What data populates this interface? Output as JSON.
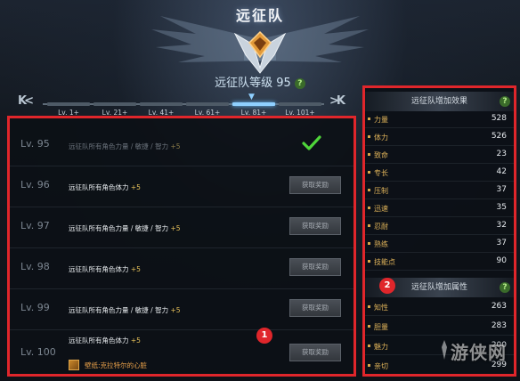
{
  "header": {
    "title": "远征队",
    "level_text": "远征队等级 95",
    "help": "?"
  },
  "nav": {
    "prev": "K<",
    "next": ">K",
    "tiers": [
      {
        "label": "Lv. 1+",
        "active": false
      },
      {
        "label": "Lv. 21+",
        "active": false
      },
      {
        "label": "Lv. 41+",
        "active": false
      },
      {
        "label": "Lv. 61+",
        "active": false
      },
      {
        "label": "Lv. 81+",
        "active": true
      },
      {
        "label": "Lv. 101+",
        "active": false
      }
    ]
  },
  "rewards": [
    {
      "level": "Lv. 95",
      "desc": "远征队所有角色力量 / 敏捷 / 智力",
      "bonus": "+5",
      "claimed": true,
      "button": ""
    },
    {
      "level": "Lv. 96",
      "desc": "远征队所有角色体力",
      "bonus": "+5",
      "claimed": false,
      "button": "获取奖励"
    },
    {
      "level": "Lv. 97",
      "desc": "远征队所有角色力量 / 敏捷 / 智力",
      "bonus": "+5",
      "claimed": false,
      "button": "获取奖励"
    },
    {
      "level": "Lv. 98",
      "desc": "远征队所有角色体力",
      "bonus": "+5",
      "claimed": false,
      "button": "获取奖励"
    },
    {
      "level": "Lv. 99",
      "desc": "远征队所有角色力量 / 敏捷 / 智力",
      "bonus": "+5",
      "claimed": false,
      "button": "获取奖励"
    },
    {
      "level": "Lv. 100",
      "desc": "远征队所有角色体力",
      "bonus": "+5",
      "claimed": false,
      "button": "获取奖励",
      "item": "壁纸:克拉特尔的心脏"
    }
  ],
  "badges": {
    "left": "1",
    "right": "2"
  },
  "effects": {
    "title": "远征队增加效果",
    "help": "?",
    "stats": [
      {
        "name": "力量",
        "value": "528"
      },
      {
        "name": "体力",
        "value": "526"
      },
      {
        "name": "致命",
        "value": "23"
      },
      {
        "name": "专长",
        "value": "42"
      },
      {
        "name": "压制",
        "value": "37"
      },
      {
        "name": "迅速",
        "value": "35"
      },
      {
        "name": "忍耐",
        "value": "32"
      },
      {
        "name": "熟练",
        "value": "37"
      },
      {
        "name": "技能点",
        "value": "90"
      }
    ]
  },
  "attributes": {
    "title": "远征队增加属性",
    "help": "?",
    "stats": [
      {
        "name": "知性",
        "value": "263"
      },
      {
        "name": "胆量",
        "value": "283"
      },
      {
        "name": "魅力",
        "value": "200"
      },
      {
        "name": "亲切",
        "value": "299"
      }
    ]
  },
  "watermark": "游侠网",
  "colors": {
    "accent_red": "#e0262b",
    "gold": "#e0b45a",
    "active_tier": "#8fd0ff",
    "check": "#4fd63a"
  }
}
